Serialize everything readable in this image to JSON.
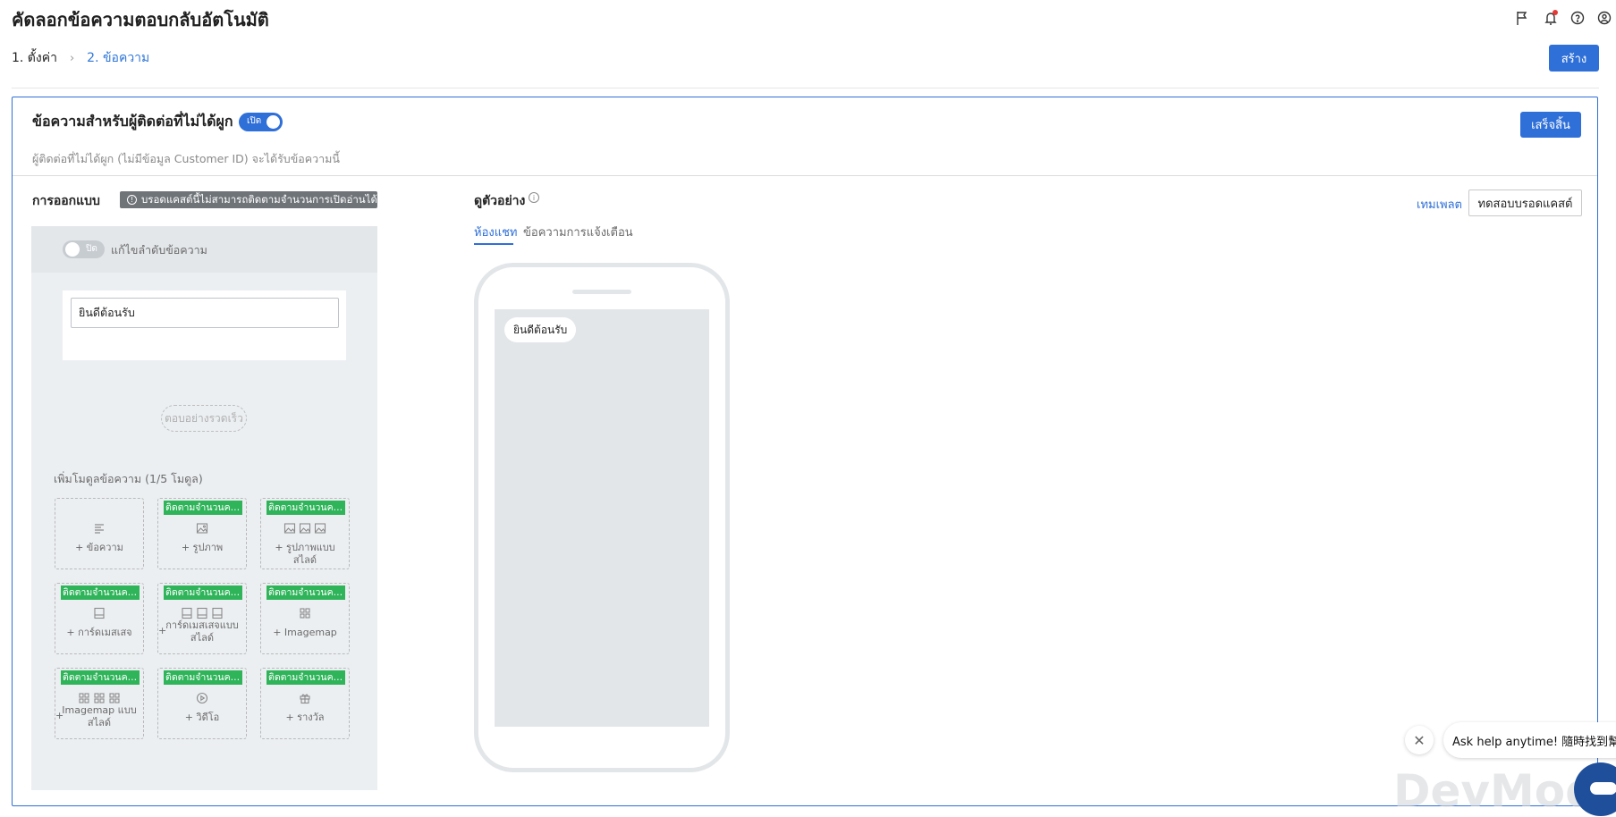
{
  "header": {
    "title": "คัดลอกข้อความตอบกลับอัตโนมัติ",
    "icons": [
      "flag-icon",
      "bell-icon",
      "help-icon",
      "user-icon"
    ]
  },
  "steps": {
    "step1": "1. ตั้งค่า",
    "separator": "›",
    "step2": "2. ข้อความ"
  },
  "create_button": "สร้าง",
  "section": {
    "title": "ข้อความสำหรับผู้ติดต่อที่ไม่ได้ผูก",
    "toggle_label": "เปิด",
    "finish_button": "เสร็จสิ้น",
    "description": "ผู้ติดต่อที่ไม่ได้ผูก (ไม่มีข้อมูล Customer ID) จะได้รับข้อความนี้"
  },
  "design": {
    "label": "การออกแบบ",
    "warning": "บรอดแคสต์นี้ไม่สามารถติดตามจำนวนการเปิดอ่านได้",
    "reorder_toggle_label": "ปิด",
    "reorder_label": "แก้ไขลำดับข้อความ",
    "message_value": "ยินดีต้อนรับ",
    "quick_reply": "ตอบอย่างรวดเร็ว",
    "modules_label": "เพิ่มโมดูลข้อความ (1/5 โมดูล)",
    "modules": [
      {
        "label": "+ ข้อความ",
        "tag": "",
        "icon": "text-lines-icon"
      },
      {
        "label": "+ รูปภาพ",
        "tag": "ติดตามจำนวนคน...",
        "icon": "image-icon"
      },
      {
        "label": "+ รูปภาพแบบสไลด์",
        "tag": "ติดตามจำนวนคน...",
        "icon": "image-carousel-icon"
      },
      {
        "label": "+ การ์ดเมสเสจ",
        "tag": "ติดตามจำนวนคน...",
        "icon": "card-icon"
      },
      {
        "label": "การ์ดเมสเสจแบบสไลด์",
        "tag": "ติดตามจำนวนคน...",
        "icon": "card-carousel-icon"
      },
      {
        "label": "+ Imagemap",
        "tag": "ติดตามจำนวนคน...",
        "icon": "imagemap-icon"
      },
      {
        "label": "Imagemap แบบสไลด์",
        "tag": "ติดตามจำนวนคน...",
        "icon": "imagemap-carousel-icon"
      },
      {
        "label": "+ วิดีโอ",
        "tag": "ติดตามจำนวนคน...",
        "icon": "video-icon"
      },
      {
        "label": "+ รางวัล",
        "tag": "ติดตามจำนวนคน...",
        "icon": "gift-icon"
      }
    ]
  },
  "preview": {
    "label": "ดูตัวอย่าง",
    "tabs": [
      "ห้องแชท",
      "ข้อความการแจ้งเตือน"
    ],
    "template_link": "เทมเพลต",
    "test_button": "ทดสอบบรอดแคสต์",
    "chat_bubble": "ยินดีต้อนรับ"
  },
  "help": {
    "text": "Ask help anytime! 隨時找到幫助!",
    "watermark": "DevMod"
  },
  "colors": {
    "primary": "#2f6fd8",
    "tag_green": "#2fb45a",
    "badge_gray": "#6f7479"
  }
}
